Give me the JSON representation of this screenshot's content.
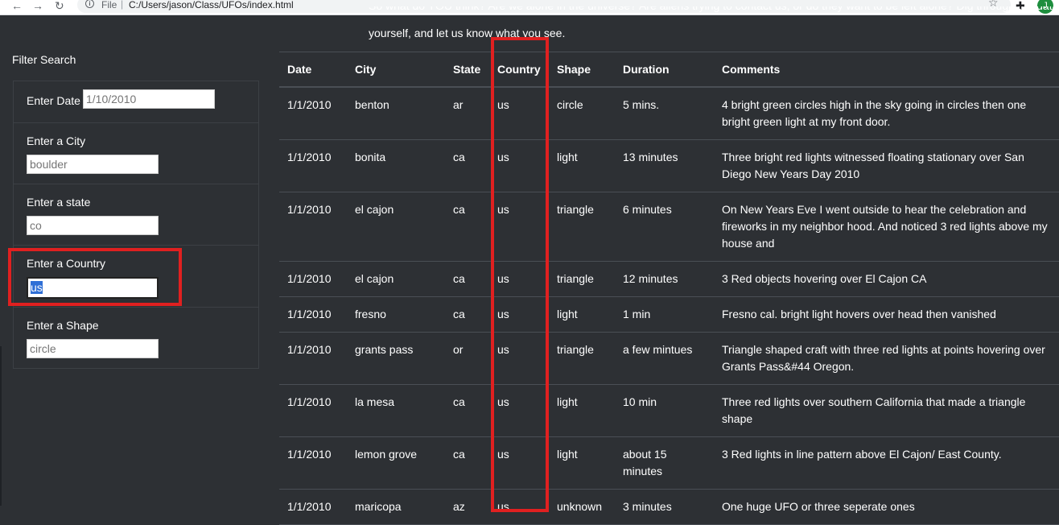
{
  "browser": {
    "scheme_label": "File",
    "separator": "|",
    "url": "C:/Users/jason/Class/UFOs/index.html",
    "avatar_initial": "J"
  },
  "intro": {
    "line1": "So what do YOU think? Are we alone in the universe? Are aliens trying to contact us, or do they want to be left alone? Dig through the data",
    "line2": "yourself, and let us know what you see."
  },
  "filters": {
    "title": "Filter Search",
    "date": {
      "label": "Enter Date",
      "placeholder": "1/10/2010"
    },
    "city": {
      "label": "Enter a City",
      "placeholder": "boulder"
    },
    "state": {
      "label": "Enter a state",
      "placeholder": "co"
    },
    "country": {
      "label": "Enter a Country",
      "value": "us"
    },
    "shape": {
      "label": "Enter a Shape",
      "placeholder": "circle"
    }
  },
  "table": {
    "headers": [
      "Date",
      "City",
      "State",
      "Country",
      "Shape",
      "Duration",
      "Comments"
    ],
    "rows": [
      [
        "1/1/2010",
        "benton",
        "ar",
        "us",
        "circle",
        "5 mins.",
        "4 bright green circles high in the sky going in circles then one bright green light at my front door."
      ],
      [
        "1/1/2010",
        "bonita",
        "ca",
        "us",
        "light",
        "13 minutes",
        "Three bright red lights witnessed floating stationary over San Diego New Years Day 2010"
      ],
      [
        "1/1/2010",
        "el cajon",
        "ca",
        "us",
        "triangle",
        "6 minutes",
        "On New Years Eve I went outside to hear the celebration and fireworks in my neighbor hood. And noticed 3 red lights above my house and"
      ],
      [
        "1/1/2010",
        "el cajon",
        "ca",
        "us",
        "triangle",
        "12 minutes",
        "3 Red objects hovering over El Cajon CA"
      ],
      [
        "1/1/2010",
        "fresno",
        "ca",
        "us",
        "light",
        "1 min",
        "Fresno cal. bright light hovers over head then vanished"
      ],
      [
        "1/1/2010",
        "grants pass",
        "or",
        "us",
        "triangle",
        "a few mintues",
        "Triangle shaped craft with three red lights at points hovering over Grants Pass&#44 Oregon."
      ],
      [
        "1/1/2010",
        "la mesa",
        "ca",
        "us",
        "light",
        "10 min",
        "Three red lights over southern California that made a triangle shape"
      ],
      [
        "1/1/2010",
        "lemon grove",
        "ca",
        "us",
        "light",
        "about 15 minutes",
        "3 Red lights in line pattern above El Cajon/ East County."
      ],
      [
        "1/1/2010",
        "maricopa",
        "az",
        "us",
        "unknown",
        "3 minutes",
        "One huge UFO or three seperate ones"
      ]
    ]
  },
  "colors": {
    "background": "#2d3034",
    "highlight": "#e02020",
    "selection": "#2f6fd6"
  }
}
